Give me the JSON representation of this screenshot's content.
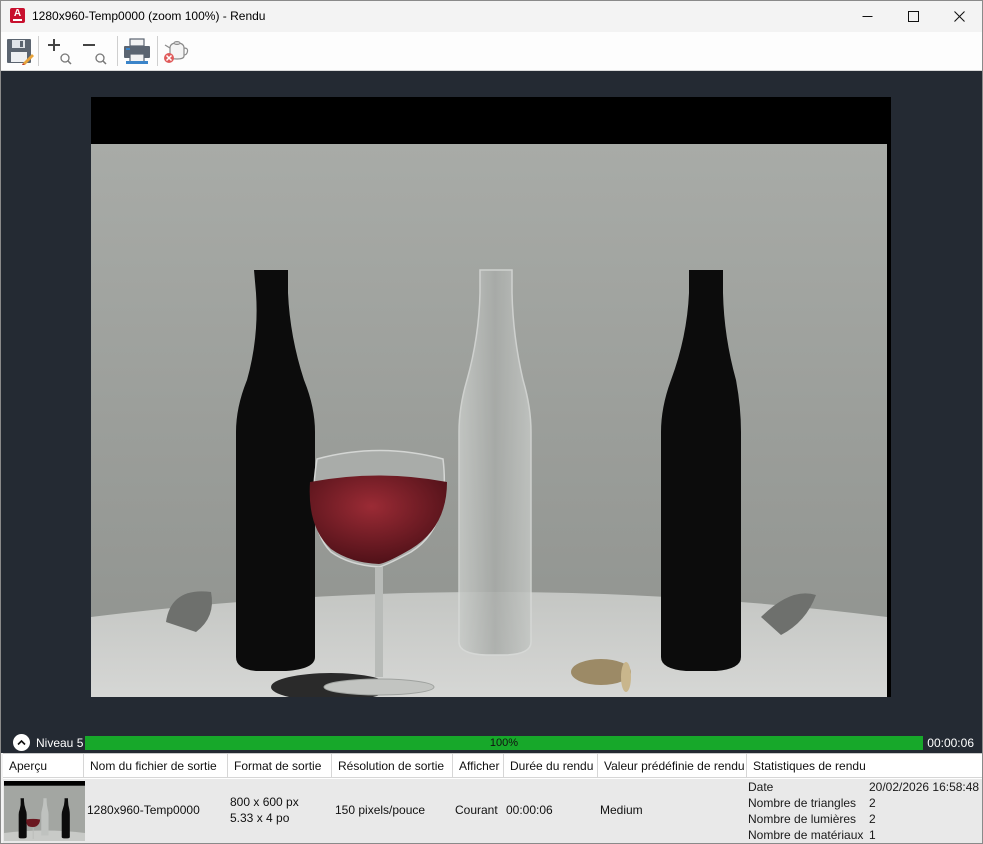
{
  "window": {
    "title": "1280x960-Temp0000 (zoom 100%) - Rendu"
  },
  "app_icon": {
    "letter": "A"
  },
  "title_controls": [
    "minimize-icon",
    "maximize-icon",
    "close-icon"
  ],
  "toolbar": {
    "buttons": [
      "save-icon",
      "zoom-in-icon",
      "zoom-out-icon",
      "print-icon",
      "cancel-render-icon"
    ]
  },
  "progress": {
    "level_label": "Niveau 5",
    "percent_text": "100%",
    "fraction": 1.0,
    "elapsed": "00:00:06",
    "fill_color": "#17a82a"
  },
  "history": {
    "columns": [
      "Aperçu",
      "Nom du fichier de sortie",
      "Format de sortie",
      "Résolution de sortie",
      "Afficher",
      "Durée du rendu",
      "Valeur prédéfinie de rendu",
      "Statistiques de rendu"
    ],
    "row": {
      "filename": "1280x960-Temp0000",
      "format_px": "800 x 600 px",
      "format_in": "5.33 x 4 po",
      "resolution": "150 pixels/pouce",
      "display": "Courant",
      "duration": "00:00:06",
      "preset": "Medium",
      "stats": [
        {
          "label": "Date",
          "value": "20/02/2026 16:58:48"
        },
        {
          "label": "Nombre de triangles",
          "value": "2"
        },
        {
          "label": "Nombre de lumières",
          "value": "2"
        },
        {
          "label": "Nombre de matériaux",
          "value": "1"
        }
      ]
    }
  },
  "colors": {
    "viewport_bg": "#242a33",
    "accent_red": "#c8102e"
  }
}
